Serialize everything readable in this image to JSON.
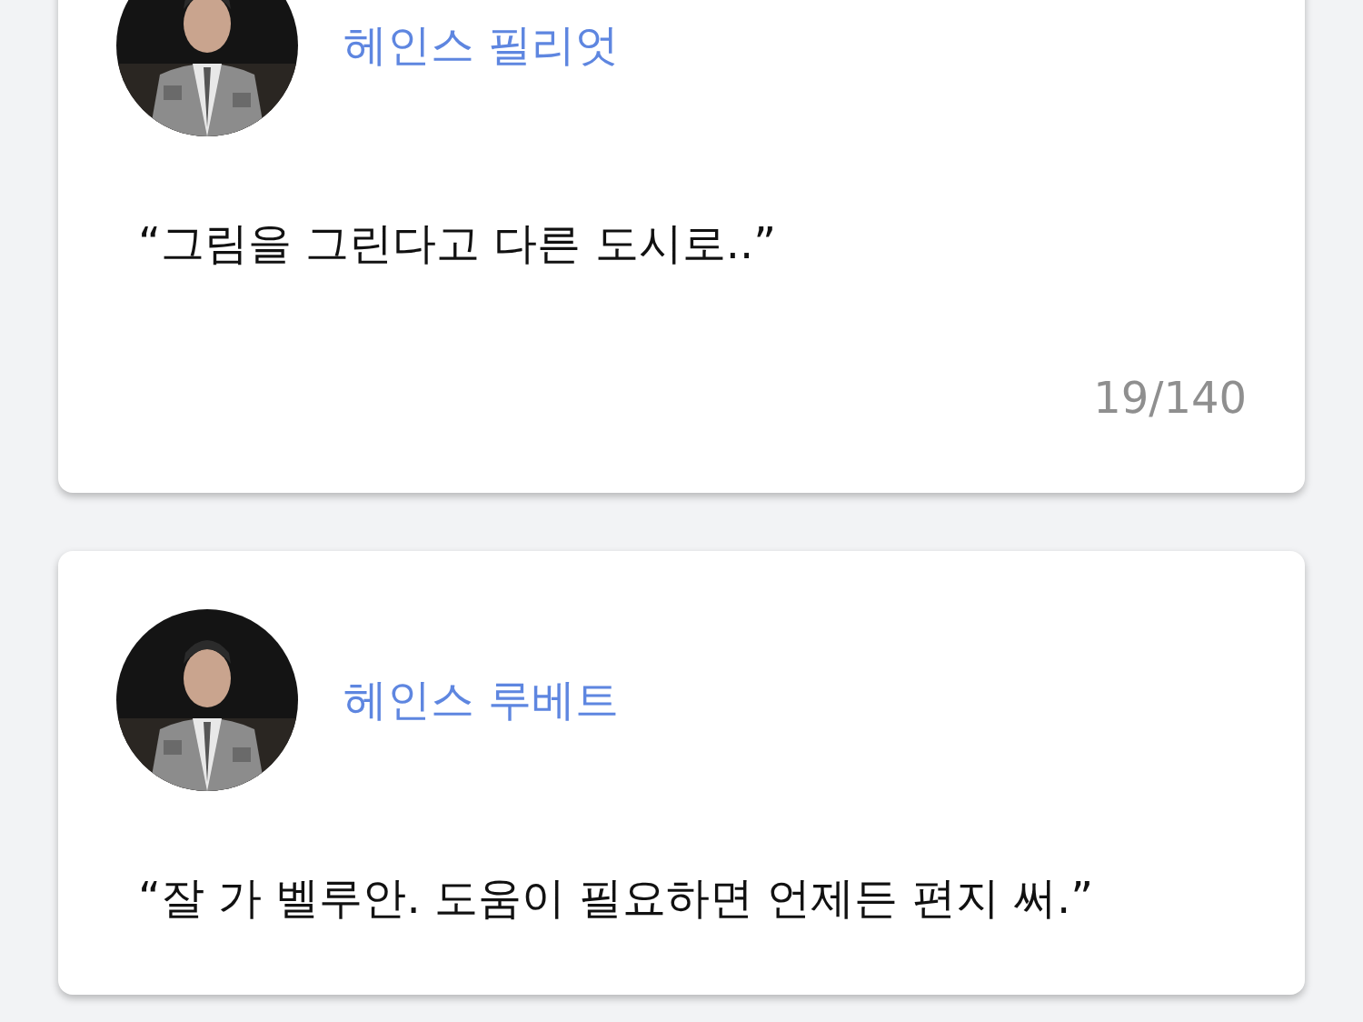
{
  "cards": [
    {
      "name": "헤인스 필리엇",
      "quote": "“그림을 그린다고 다른 도시로..”",
      "counter": "19/140"
    },
    {
      "name": "헤인스 루베트",
      "quote": "“잘 가 벨루안. 도움이 필요하면 언제든 편지 써.”"
    }
  ]
}
